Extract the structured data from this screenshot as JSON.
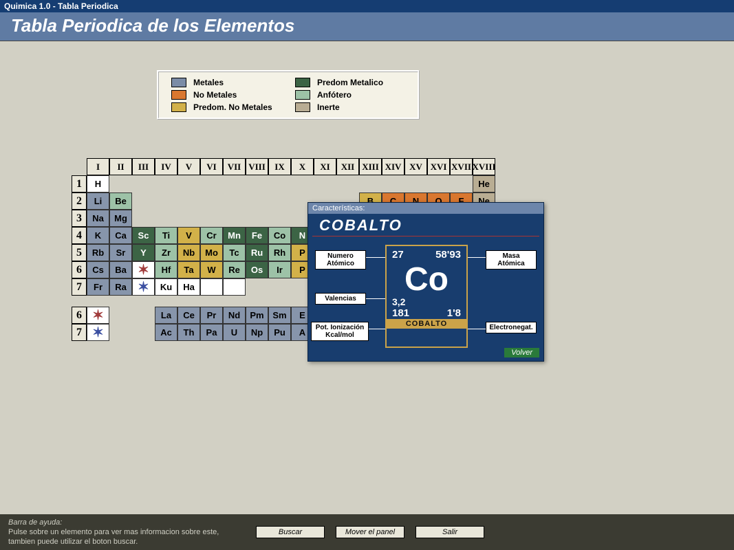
{
  "window_title": "Quimica 1.0 - Tabla Periodica",
  "header": "Tabla Periodica de los Elementos",
  "legend": {
    "metales": "Metales",
    "nometales": "No Metales",
    "prednm": "Predom. No Metales",
    "predmet": "Predom Metalico",
    "anfotero": "Anfótero",
    "inerte": "Inerte"
  },
  "groups": [
    "I",
    "II",
    "III",
    "IV",
    "V",
    "VI",
    "VII",
    "VIII",
    "IX",
    "X",
    "XI",
    "XII",
    "XIII",
    "XIV",
    "XV",
    "XVI",
    "XVII",
    "XVIII"
  ],
  "periods": [
    "1",
    "2",
    "3",
    "4",
    "5",
    "6",
    "7"
  ],
  "row1": {
    "h": "H",
    "he": "He"
  },
  "row2": {
    "li": "Li",
    "be": "Be",
    "b": "B",
    "c": "C",
    "n": "N",
    "o": "O",
    "f": "F",
    "ne": "Ne"
  },
  "row3": {
    "na": "Na",
    "mg": "Mg"
  },
  "row4": {
    "k": "K",
    "ca": "Ca",
    "sc": "Sc",
    "ti": "Ti",
    "v": "V",
    "cr": "Cr",
    "mn": "Mn",
    "fe": "Fe",
    "co": "Co",
    "ni": "N"
  },
  "row5": {
    "rb": "Rb",
    "sr": "Sr",
    "y": "Y",
    "zr": "Zr",
    "nb": "Nb",
    "mo": "Mo",
    "tc": "Tc",
    "ru": "Ru",
    "rh": "Rh",
    "pd": "P"
  },
  "row6": {
    "cs": "Cs",
    "ba": "Ba",
    "hf": "Hf",
    "ta": "Ta",
    "w": "W",
    "re": "Re",
    "os": "Os",
    "ir": "Ir",
    "pt": "P"
  },
  "row7": {
    "fr": "Fr",
    "ra": "Ra",
    "ku": "Ku",
    "ha": "Ha"
  },
  "fblock_periods": [
    "6",
    "7"
  ],
  "lan": {
    "la": "La",
    "ce": "Ce",
    "pr": "Pr",
    "nd": "Nd",
    "pm": "Pm",
    "sm": "Sm",
    "eu": "E"
  },
  "act": {
    "ac": "Ac",
    "th": "Th",
    "pa": "Pa",
    "u": "U",
    "np": "Np",
    "pu": "Pu",
    "am": "A"
  },
  "detail": {
    "panel_title": "Características:",
    "name": "COBALTO",
    "symbol": "Co",
    "atomic_number": "27",
    "mass": "58'93",
    "valencias": "3,2",
    "ionization": "181",
    "electroneg": "1'8",
    "label_na": "Numero Atómico",
    "label_ma": "Masa Atómica",
    "label_va": "Valencias",
    "label_en": "Electronegat.",
    "label_pi": "Pot. Ionización Kcal/mol",
    "volver": "Volver"
  },
  "bottom": {
    "help_title": "Barra de ayuda:",
    "help_text": "Pulse sobre un elemento para ver mas informacion sobre este, tambien puede utilizar el boton buscar.",
    "buscar": "Buscar",
    "mover": "Mover el panel",
    "salir": "Salir"
  }
}
